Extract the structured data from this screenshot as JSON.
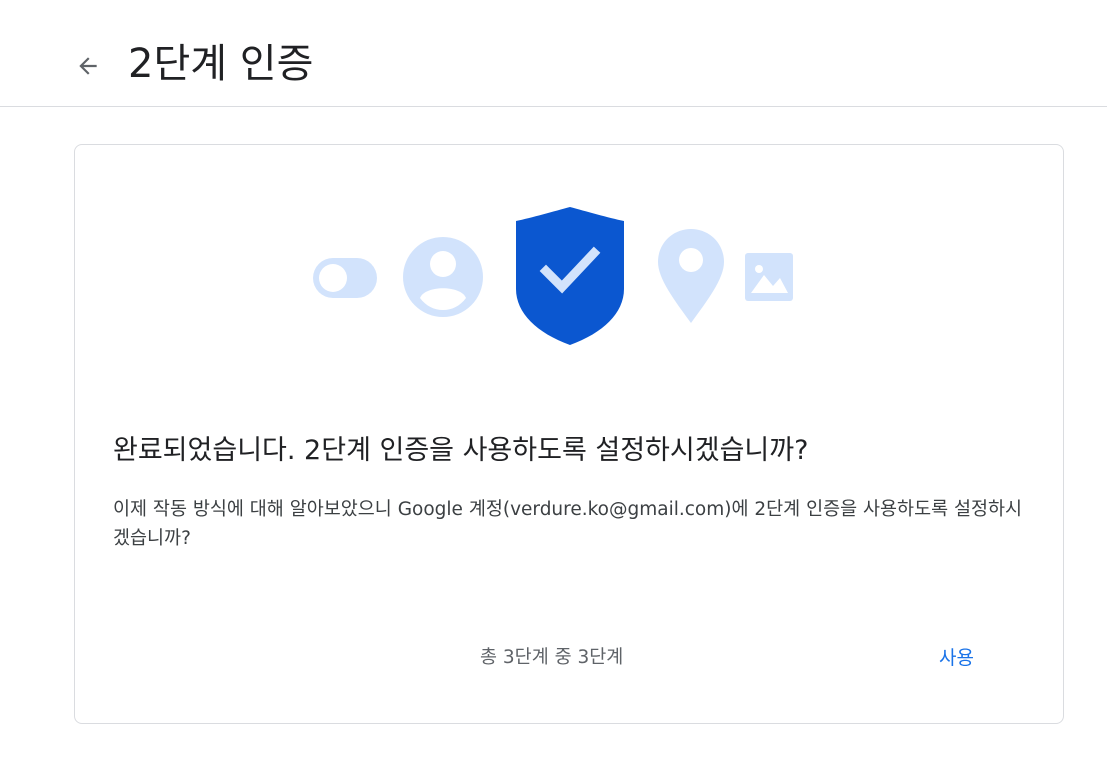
{
  "header": {
    "title": "2단계 인증"
  },
  "card": {
    "heading": "완료되었습니다. 2단계 인증을 사용하도록 설정하시겠습니까?",
    "description": "이제 작동 방식에 대해 알아보았으니 Google 계정(verdure.ko@gmail.com)에 2단계 인증을 사용하도록 설정하시겠습니까?",
    "step_indicator": "총 3단계 중 3단계",
    "enable_button": "사용"
  },
  "illustration": {
    "icons": [
      "toggle-icon",
      "account-icon",
      "shield-check-icon",
      "location-pin-icon",
      "image-icon"
    ]
  },
  "colors": {
    "accent": "#1a73e8",
    "shield": "#0b57d0",
    "icon_light": "#d2e3fc"
  }
}
